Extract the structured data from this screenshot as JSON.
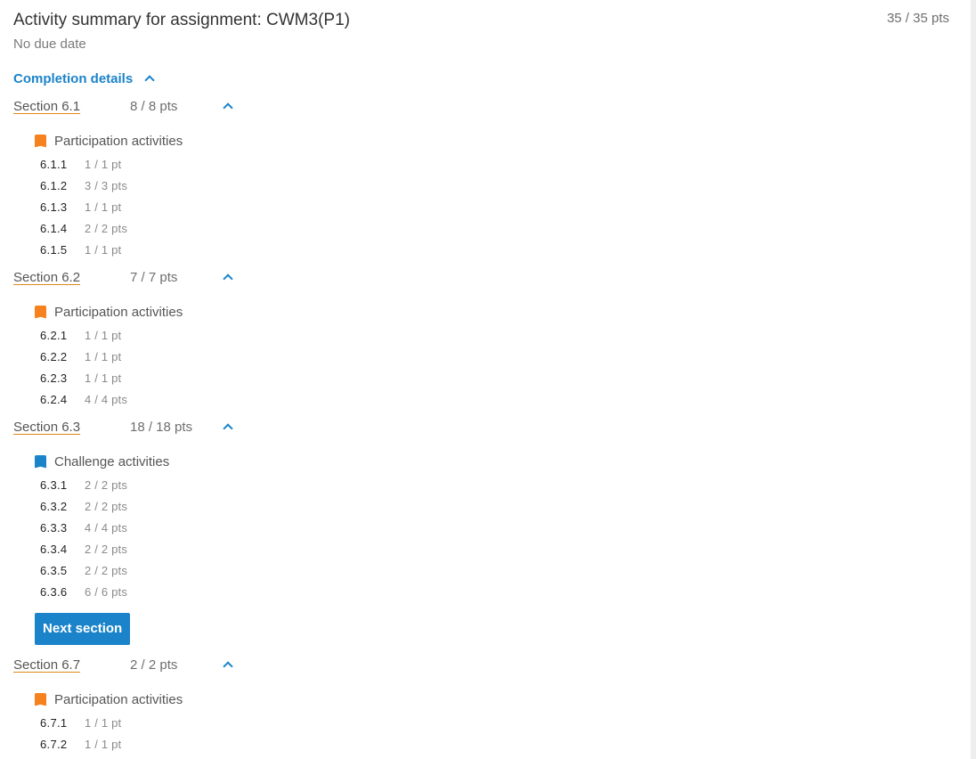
{
  "header": {
    "title": "Activity summary for assignment: CWM3(P1)",
    "due": "No due date",
    "total": "35 / 35 pts"
  },
  "completion": {
    "label": "Completion details"
  },
  "colors": {
    "participation": "#f5821f",
    "challenge": "#1a83c9",
    "accent": "#1a83c9"
  },
  "sections": [
    {
      "link": "Section 6.1",
      "pts": "8 / 8 pts",
      "group": "Participation activities",
      "type": "participation",
      "items": [
        {
          "id": "6.1.1",
          "pts": "1 / 1 pt"
        },
        {
          "id": "6.1.2",
          "pts": "3 / 3 pts"
        },
        {
          "id": "6.1.3",
          "pts": "1 / 1 pt"
        },
        {
          "id": "6.1.4",
          "pts": "2 / 2 pts"
        },
        {
          "id": "6.1.5",
          "pts": "1 / 1 pt"
        }
      ]
    },
    {
      "link": "Section 6.2",
      "pts": "7 / 7 pts",
      "group": "Participation activities",
      "type": "participation",
      "items": [
        {
          "id": "6.2.1",
          "pts": "1 / 1 pt"
        },
        {
          "id": "6.2.2",
          "pts": "1 / 1 pt"
        },
        {
          "id": "6.2.3",
          "pts": "1 / 1 pt"
        },
        {
          "id": "6.2.4",
          "pts": "4 / 4 pts"
        }
      ]
    },
    {
      "link": "Section 6.3",
      "pts": "18 / 18 pts",
      "group": "Challenge activities",
      "type": "challenge",
      "items": [
        {
          "id": "6.3.1",
          "pts": "2 / 2 pts"
        },
        {
          "id": "6.3.2",
          "pts": "2 / 2 pts"
        },
        {
          "id": "6.3.3",
          "pts": "4 / 4 pts"
        },
        {
          "id": "6.3.4",
          "pts": "2 / 2 pts"
        },
        {
          "id": "6.3.5",
          "pts": "2 / 2 pts"
        },
        {
          "id": "6.3.6",
          "pts": "6 / 6 pts"
        }
      ],
      "next_button": "Next section"
    },
    {
      "link": "Section 6.7",
      "pts": "2 / 2 pts",
      "group": "Participation activities",
      "type": "participation",
      "items": [
        {
          "id": "6.7.1",
          "pts": "1 / 1 pt"
        },
        {
          "id": "6.7.2",
          "pts": "1 / 1 pt"
        }
      ]
    }
  ]
}
